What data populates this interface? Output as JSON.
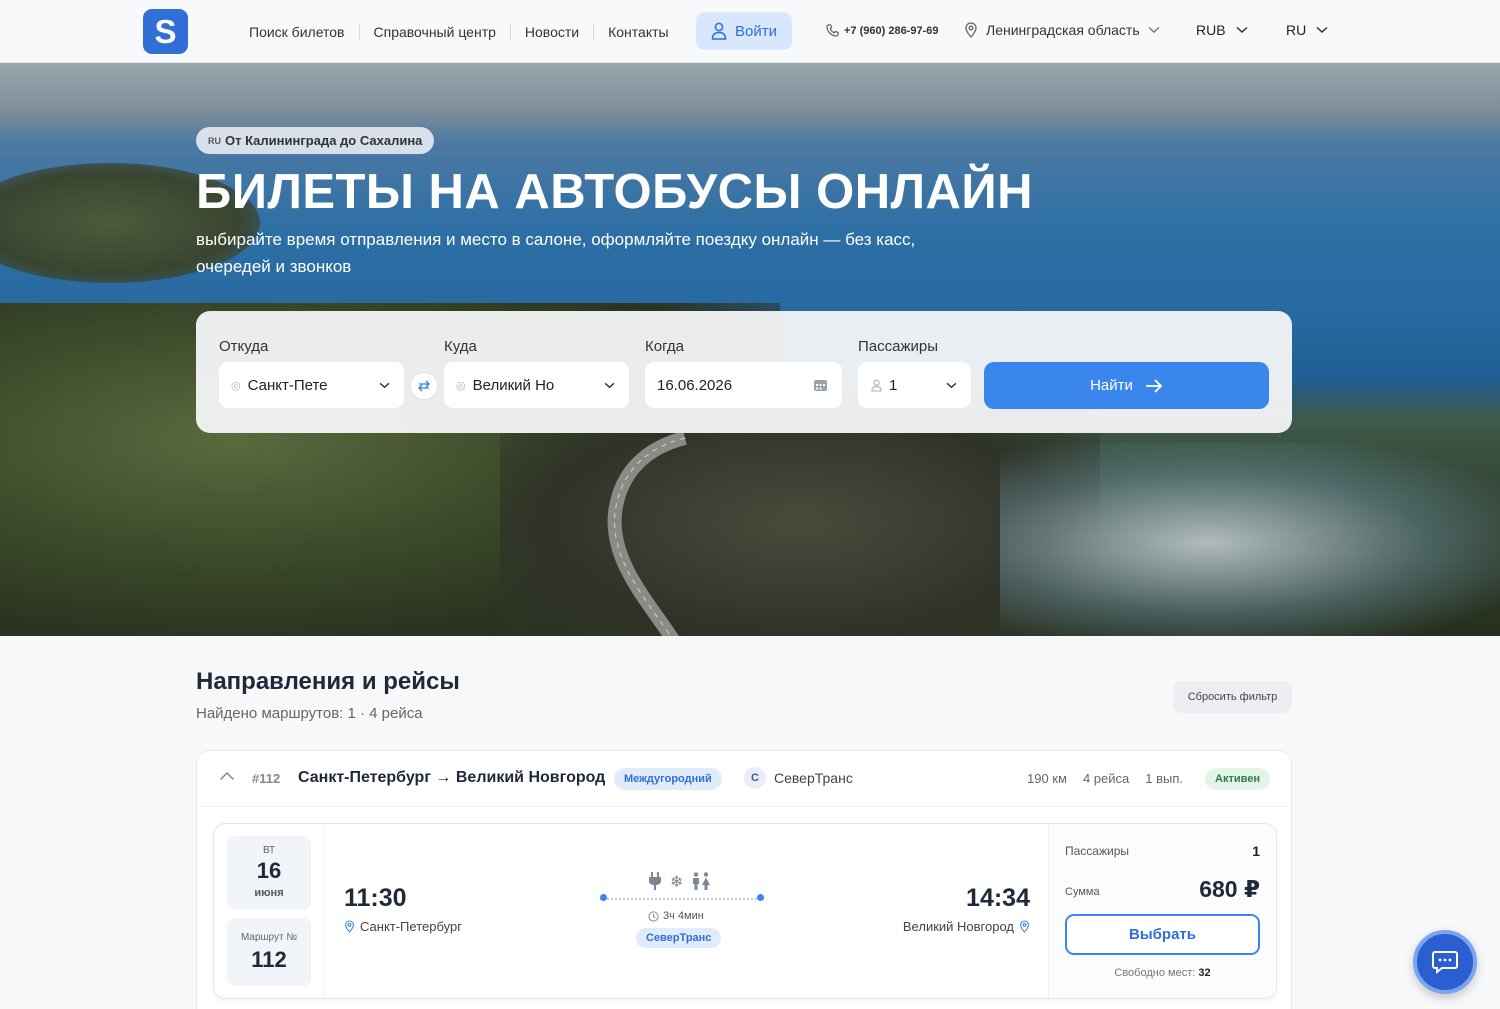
{
  "header": {
    "logo_letter": "S",
    "nav": [
      "Поиск билетов",
      "Справочный центр",
      "Новости",
      "Контакты"
    ],
    "login_label": "Войти",
    "phone": "+7 (960) 286-97-69",
    "region": "Ленинградская область",
    "currency": "RUB",
    "language": "RU"
  },
  "hero": {
    "badge_flag": "RU",
    "badge_text": "От Калининграда до Сахалина",
    "title": "БИЛЕТЫ НА АВТОБУСЫ ОНЛАЙН",
    "subtitle": "выбирайте время отправления и место в салоне, оформляйте поездку онлайн — без касс, очередей и звонков"
  },
  "search": {
    "from_label": "Откуда",
    "from_value": "Санкт-Пете",
    "to_label": "Куда",
    "to_value": "Великий Но",
    "date_label": "Когда",
    "date_value": "16.06.2026",
    "passengers_label": "Пассажиры",
    "passengers_value": "1",
    "find_label": "Найти"
  },
  "directions": {
    "title": "Направления и рейсы",
    "subtitle": "Найдено маршрутов: 1 · 4 рейса",
    "reset_label": "Сбросить фильтр",
    "route": {
      "number": "#112",
      "title": "Санкт-Петербург → Великий Новгород",
      "type": "Междугородний",
      "carrier_initial": "С",
      "carrier": "СеверТранс",
      "distance": "190 км",
      "trips": "4 рейса",
      "departures": "1 вып.",
      "status": "Активен"
    },
    "trip": {
      "weekday": "ВТ",
      "day": "16",
      "month": "июня",
      "route_label": "Маршрут №",
      "route_number": "112",
      "departure_time": "11:30",
      "departure_city": "Санкт-Петербург",
      "arrival_time": "14:34",
      "arrival_city": "Великий Новгород",
      "duration": "3ч 4мин",
      "carrier": "СеверТранс",
      "passengers_label": "Пассажиры",
      "passengers_value": "1",
      "sum_label": "Сумма",
      "sum_value": "680 ₽",
      "select_label": "Выбрать",
      "seats_label": "Свободно мест:",
      "seats_value": "32"
    }
  },
  "colors": {
    "accent": "#3b86ec",
    "brand": "#2f6fd6",
    "status_active": "#2e7d4a"
  }
}
